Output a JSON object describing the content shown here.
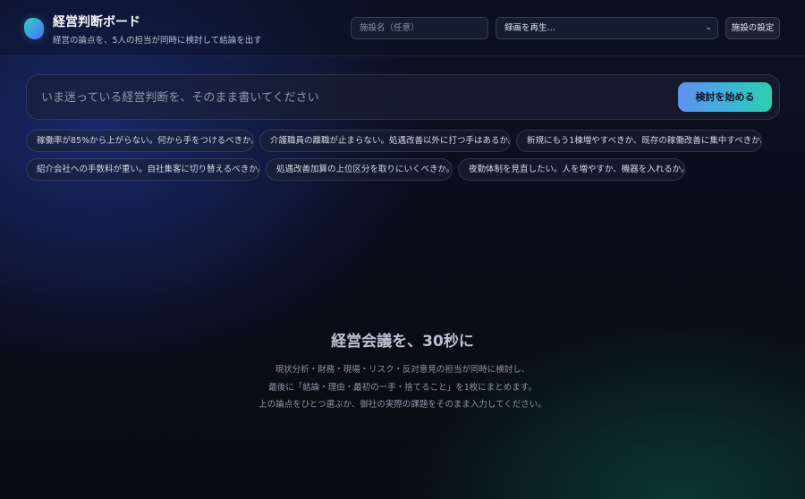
{
  "header": {
    "title": "経営判断ボード",
    "subtitle": "経営の論点を、5人の担当が同時に検討して結論を出す",
    "facility_placeholder": "施設名（任意）",
    "recording_select": "録画を再生…",
    "settings_label": "施設の設定"
  },
  "prompt": {
    "placeholder": "いま迷っている経営判断を、そのまま書いてください",
    "start_label": "検討を始める"
  },
  "suggestions": [
    "稼働率が85%から上がらない。何から手をつけるべきか。",
    "介護職員の離職が止まらない。処遇改善以外に打つ手はあるか。",
    "新規にもう1棟増やすべきか、既存の稼働改善に集中すべきか。",
    "紹介会社への手数料が重い。自社集客に切り替えるべきか。",
    "処遇改善加算の上位区分を取りにいくべきか。",
    "夜勤体制を見直したい。人を増やすか、機器を入れるか。"
  ],
  "empty_state": {
    "title": "経営会議を、30秒に",
    "lines": [
      "現状分析・財務・現場・リスク・反対意見の担当が同時に検討し、",
      "最後に「結論・理由・最初の一手・捨てること」を1枚にまとめます。",
      "上の論点をひとつ選ぶか、御社の実際の課題をそのまま入力してください。"
    ]
  },
  "icons": {
    "logo": "app-logo-icon",
    "select_chevron": "chevron-down-icon"
  }
}
